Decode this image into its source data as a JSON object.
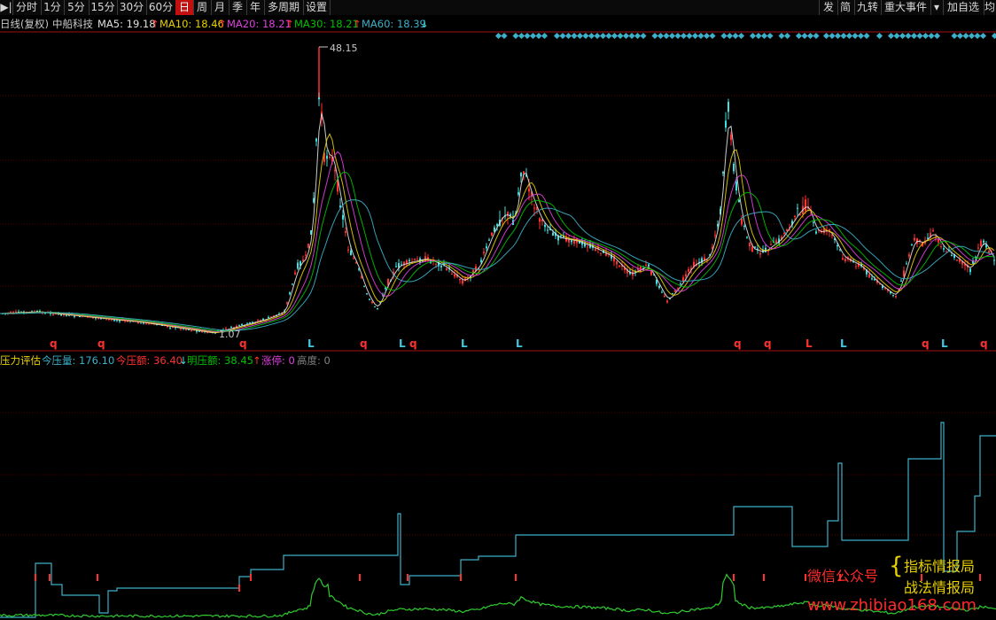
{
  "toolbar": {
    "left_items": [
      "分时",
      "1分",
      "5分",
      "15分",
      "30分",
      "60分",
      "日",
      "周",
      "月",
      "季",
      "年",
      "多周期",
      "设置"
    ],
    "active_item": "日",
    "right_items": [
      "发",
      "简",
      "九转",
      "重大事件",
      "加自选",
      "均"
    ]
  },
  "main_legend": {
    "period_label": "日线(复权)",
    "stock_name": "中船科技",
    "ma5": "MA5: 19.18",
    "ma10": "MA10: 18.46",
    "ma20": "MA20: 18.21",
    "ma30": "MA30: 18.21",
    "ma60": "MA60: 18.39"
  },
  "price_labels": {
    "high": "48.15",
    "low": "1.07"
  },
  "signal_markers": [
    "q",
    "q",
    "q",
    "L",
    "q",
    "L",
    "q",
    "L",
    "L",
    "q",
    "q",
    "L",
    "L",
    "q",
    "L",
    "q"
  ],
  "indicator_legend": {
    "title": "压力评估",
    "today_pressure": "今压量: 176.10",
    "pressure_amount": "今压额: 36.40",
    "clear_pressure": "明压额: 38.45",
    "limit_up": "涨停: 0",
    "height": "高度: 0"
  },
  "watermark": {
    "line_left": "微信公众号",
    "line_right1": "指标情报局",
    "line_right2": "战法情报局",
    "url": "www.zhibiao168.com"
  },
  "colors": {
    "ma5": "#e0e0e0",
    "ma10": "#e8d000",
    "ma20": "#e040e0",
    "ma30": "#00c000",
    "ma60": "#3cb0c8",
    "up": "#ff3030",
    "down": "#40e0e0"
  }
}
